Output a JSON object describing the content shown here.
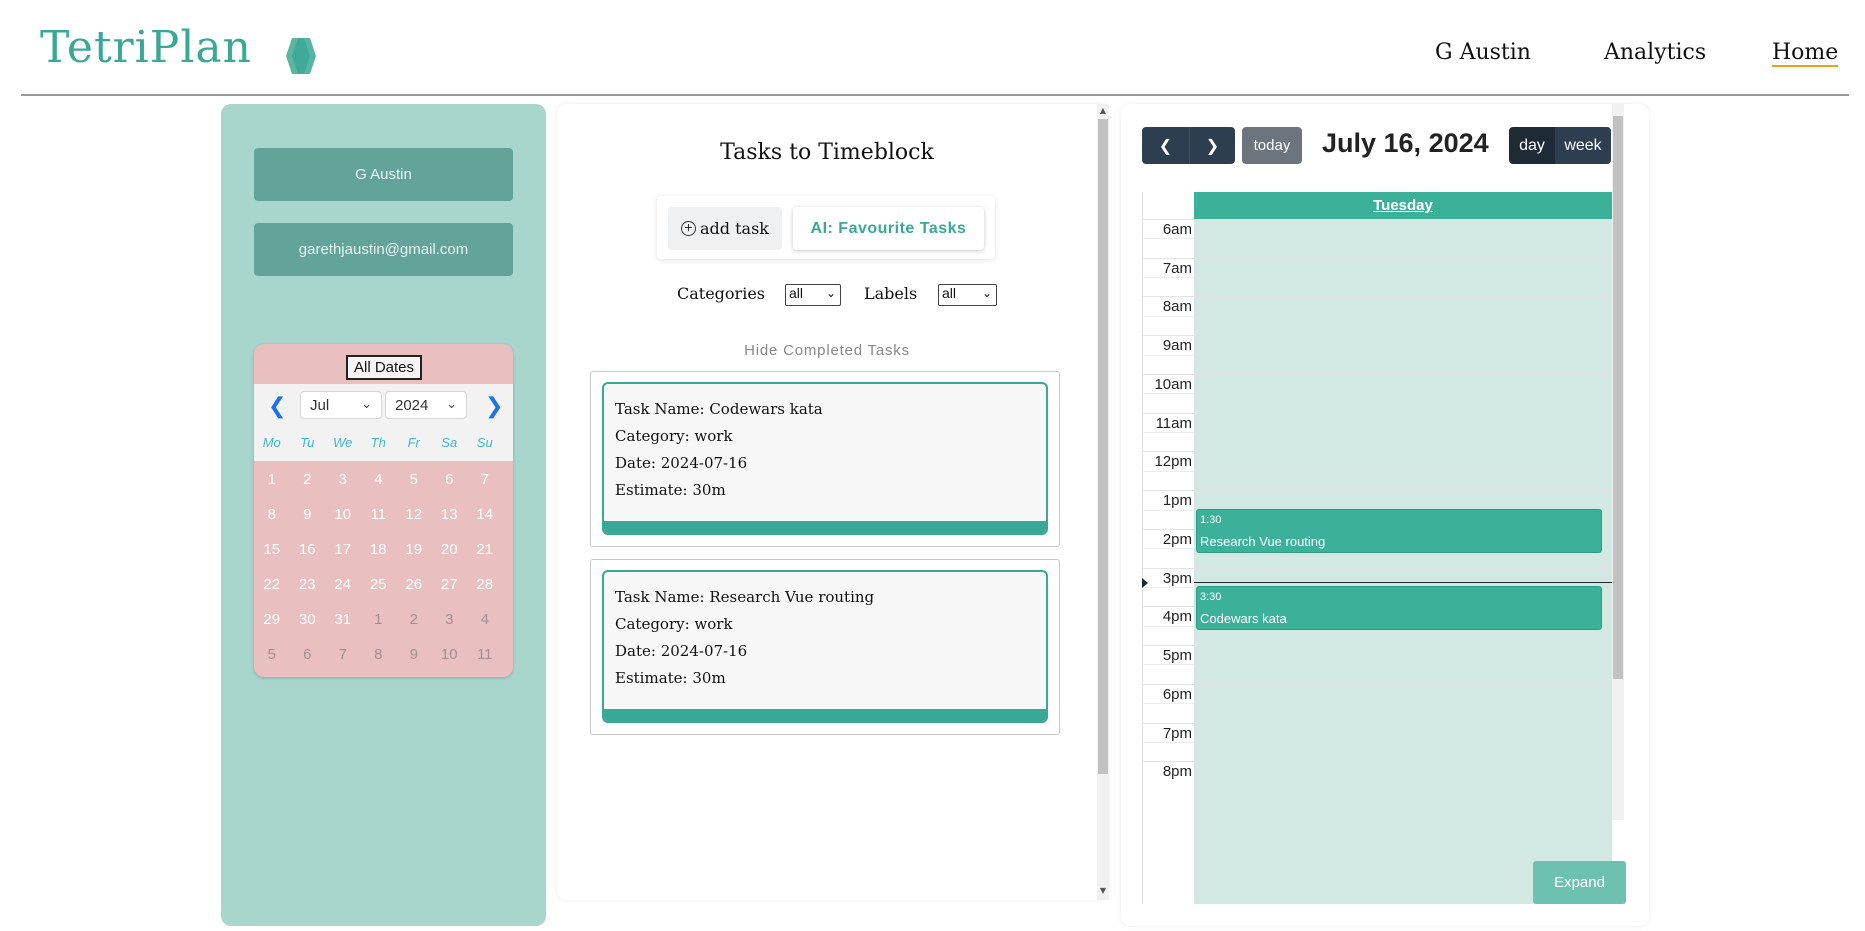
{
  "header": {
    "logo": "TetriPlan",
    "nav": [
      "G Austin",
      "Analytics",
      "Home"
    ],
    "active_nav": "Home"
  },
  "profile": {
    "name": "G Austin",
    "email": "garethjaustin@gmail.com"
  },
  "mini_calendar": {
    "all_dates_label": "All Dates",
    "month": "Jul",
    "year": "2024",
    "weekdays": [
      "Mo",
      "Tu",
      "We",
      "Th",
      "Fr",
      "Sa",
      "Su"
    ],
    "days": [
      "1",
      "2",
      "3",
      "4",
      "5",
      "6",
      "7",
      "8",
      "9",
      "10",
      "11",
      "12",
      "13",
      "14",
      "15",
      "16",
      "17",
      "18",
      "19",
      "20",
      "21",
      "22",
      "23",
      "24",
      "25",
      "26",
      "27",
      "28",
      "29",
      "30",
      "31",
      "1",
      "2",
      "3",
      "4",
      "5",
      "6",
      "7",
      "8",
      "9",
      "10",
      "11"
    ]
  },
  "tasks_panel": {
    "title": "Tasks to Timeblock",
    "add_task_label": "add task",
    "ai_favourites_label": "AI: Favourite Tasks",
    "categories_label": "Categories",
    "categories_value": "all",
    "labels_label": "Labels",
    "labels_value": "all",
    "hide_completed_label": "Hide Completed Tasks",
    "tasks": [
      {
        "name": "Task Name: Codewars kata",
        "category": "Category: work",
        "date": "Date: 2024-07-16",
        "estimate": "Estimate: 30m"
      },
      {
        "name": "Task Name: Research Vue routing",
        "category": "Category: work",
        "date": "Date: 2024-07-16",
        "estimate": "Estimate: 30m"
      }
    ]
  },
  "calendar": {
    "today_label": "today",
    "title": "July 16, 2024",
    "view_day_label": "day",
    "view_week_label": "week",
    "active_view": "day",
    "day_header": "Tuesday",
    "hours": [
      "6am",
      "7am",
      "8am",
      "9am",
      "10am",
      "11am",
      "12pm",
      "1pm",
      "2pm",
      "3pm",
      "4pm",
      "5pm",
      "6pm",
      "7pm",
      "8pm"
    ],
    "events": [
      {
        "time": "1:30",
        "title": "Research Vue routing"
      },
      {
        "time": "3:30",
        "title": "Codewars kata"
      }
    ],
    "expand_label": "Expand",
    "accent_color": "#3bb19a"
  }
}
